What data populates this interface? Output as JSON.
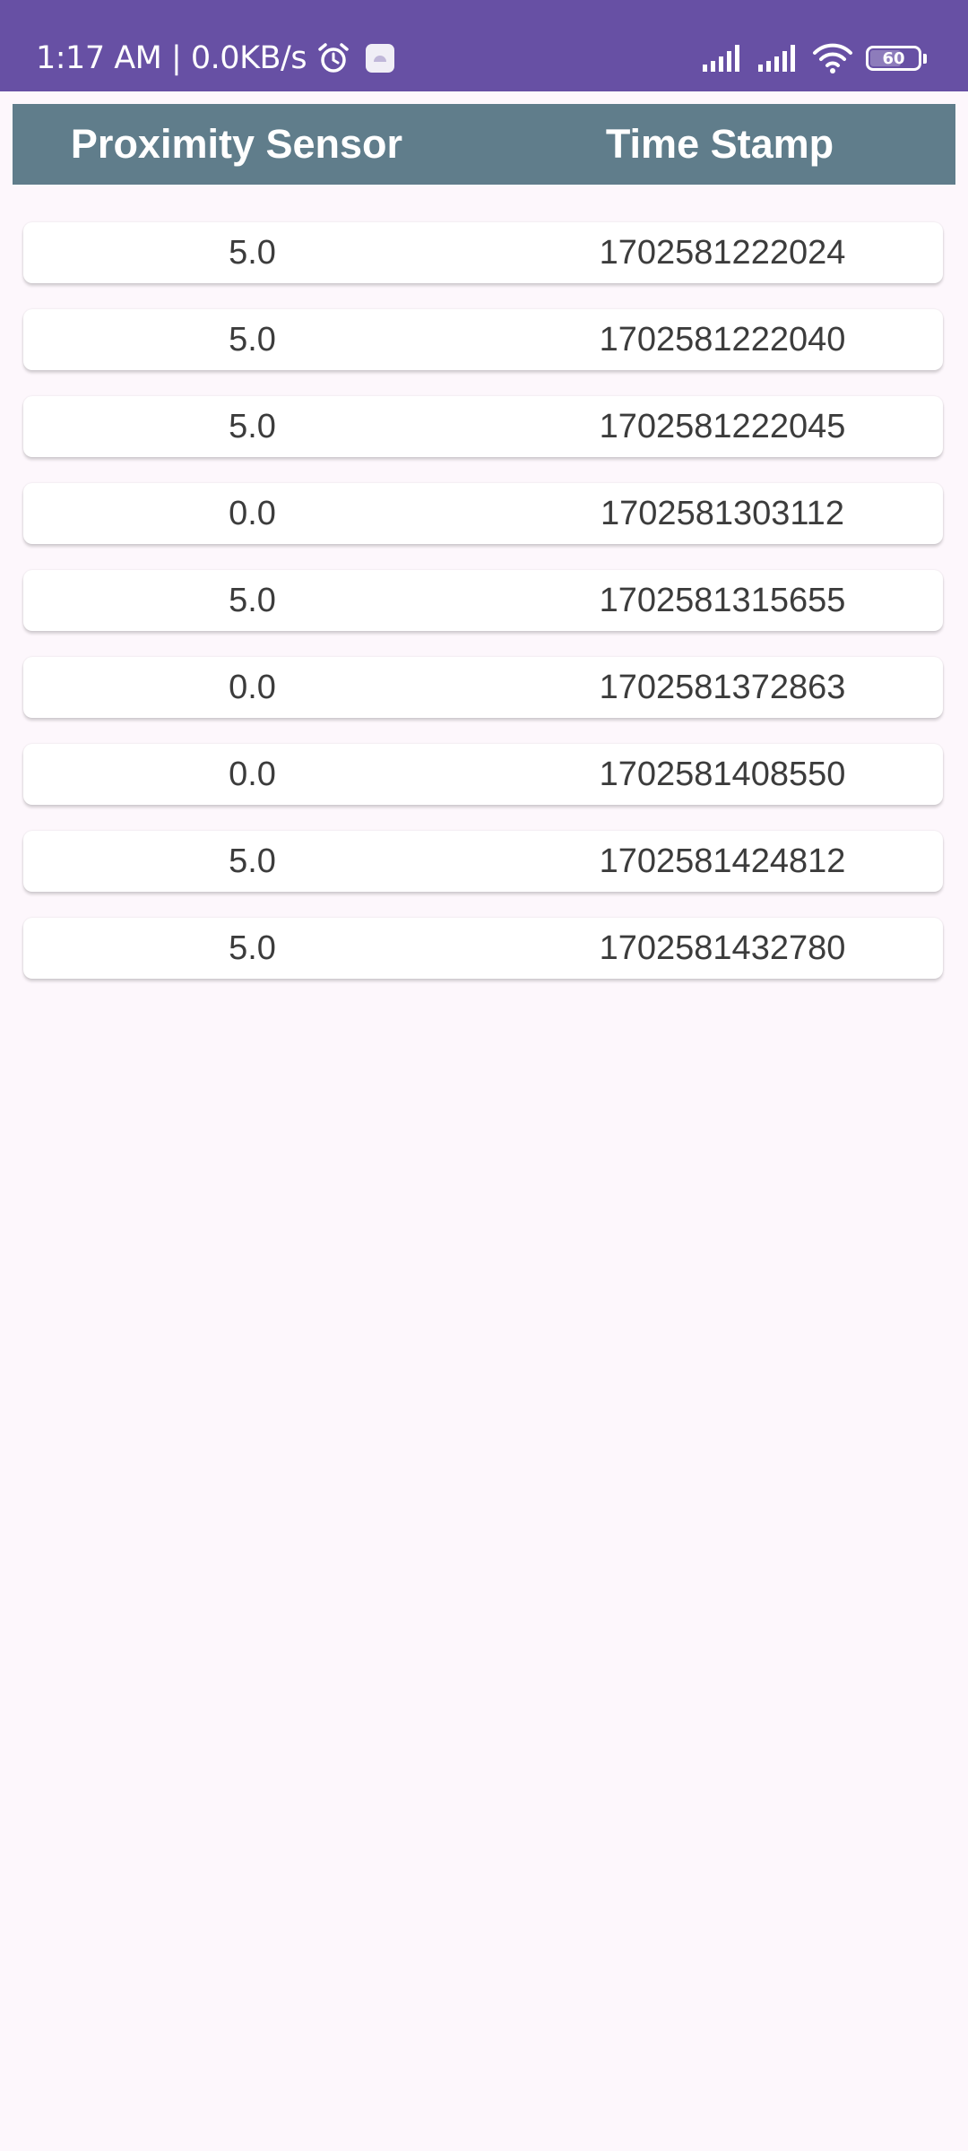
{
  "status_bar": {
    "time": "1:17 AM | 0.0KB/s",
    "icons_left": [
      "alarm-clock-icon",
      "app-notification-icon"
    ],
    "icons_right": [
      "signal-icon",
      "signal-icon",
      "wifi-icon",
      "battery-icon"
    ],
    "battery_level": "60",
    "color": "#6750a4"
  },
  "table": {
    "header_color": "#607d8b",
    "headers": {
      "sensor": "Proximity Sensor",
      "timestamp": "Time Stamp"
    },
    "rows": [
      {
        "value": "5.0",
        "timestamp": "1702581222024"
      },
      {
        "value": "5.0",
        "timestamp": "1702581222040"
      },
      {
        "value": "5.0",
        "timestamp": "1702581222045"
      },
      {
        "value": "0.0",
        "timestamp": "1702581303112"
      },
      {
        "value": "5.0",
        "timestamp": "1702581315655"
      },
      {
        "value": "0.0",
        "timestamp": "1702581372863"
      },
      {
        "value": "0.0",
        "timestamp": "1702581408550"
      },
      {
        "value": "5.0",
        "timestamp": "1702581424812"
      },
      {
        "value": "5.0",
        "timestamp": "1702581432780"
      }
    ]
  }
}
